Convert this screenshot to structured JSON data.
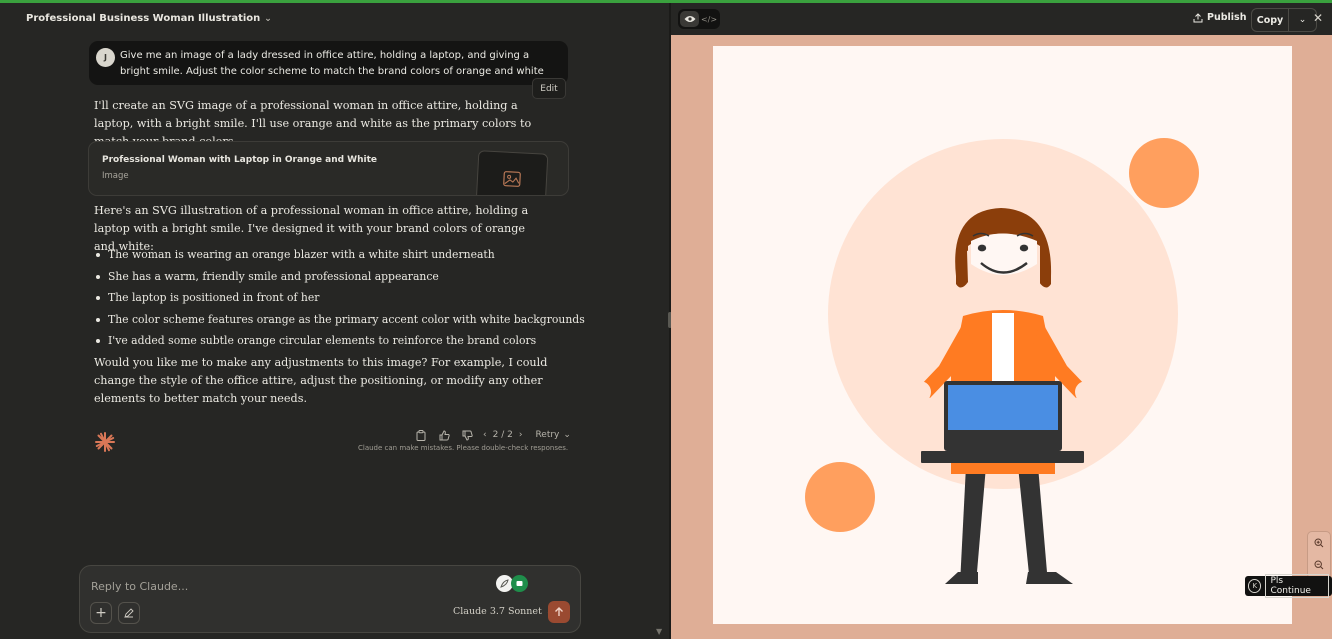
{
  "chat": {
    "title": "Professional Business Woman Illustration",
    "user_message": {
      "avatar_initial": "J",
      "text": "Give me an image of a lady dressed in office attire, holding a laptop, and giving a bright smile. Adjust the color scheme to match the brand colors of orange and white"
    },
    "edit_label": "Edit",
    "response": {
      "intro": "I'll create an SVG image of a professional woman in office attire, holding a laptop, with a bright smile. I'll use orange and white as the primary colors to match your brand colors.",
      "artifact": {
        "title": "Professional Woman with Laptop in Orange and White",
        "type": "Image"
      },
      "summary": "Here's an SVG illustration of a professional woman in office attire, holding a laptop with a bright smile. I've designed it with your brand colors of orange and white:",
      "bullets": [
        "The woman is wearing an orange blazer with a white shirt underneath",
        "She has a warm, friendly smile and professional appearance",
        "The laptop is positioned in front of her",
        "The color scheme features orange as the primary accent color with white backgrounds",
        "I've added some subtle orange circular elements to reinforce the brand colors"
      ],
      "closing": "Would you like me to make any adjustments to this image? For example, I could change the style of the office attire, adjust the positioning, or modify any other elements to better match your needs."
    },
    "actions": {
      "pager": "2 / 2",
      "retry_label": "Retry"
    },
    "disclaimer": "Claude can make mistakes. Please double-check responses.",
    "input": {
      "placeholder": "Reply to Claude...",
      "value": ""
    },
    "model": "Claude 3.7 Sonnet"
  },
  "artifact_panel": {
    "publish_label": "Publish",
    "copy_label": "Copy",
    "extension_label": "Pls Continue"
  },
  "colors": {
    "accent_orange": "#ff8a3d",
    "light_circle": "#ff9f5e",
    "canvas_frame": "#dfae96",
    "send_button": "#9a4a31"
  }
}
